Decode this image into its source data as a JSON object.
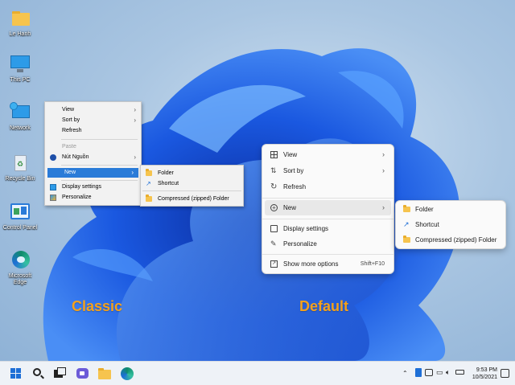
{
  "desktop_icons": [
    {
      "label": "Le Hanh",
      "icon": "folder-icon"
    },
    {
      "label": "This PC",
      "icon": "monitor-icon"
    },
    {
      "label": "Network",
      "icon": "network-icon"
    },
    {
      "label": "Recycle Bin",
      "icon": "recycle-bin-icon"
    },
    {
      "label": "Control Panel",
      "icon": "control-panel-icon"
    },
    {
      "label": "Microsoft Edge",
      "icon": "edge-icon"
    }
  ],
  "classic_menu": {
    "items": [
      {
        "label": "View",
        "has_submenu": true
      },
      {
        "label": "Sort by",
        "has_submenu": true
      },
      {
        "label": "Refresh"
      },
      {
        "label": "Paste",
        "disabled": true
      },
      {
        "label": "Nút Nguồn",
        "has_submenu": true,
        "icon": "power-icon"
      },
      {
        "label": "New",
        "has_submenu": true,
        "highlighted": true
      },
      {
        "label": "Display settings",
        "icon": "display-icon"
      },
      {
        "label": "Personalize",
        "icon": "personalize-icon"
      }
    ],
    "submenu": [
      {
        "label": "Folder",
        "icon": "folder-icon"
      },
      {
        "label": "Shortcut",
        "icon": "shortcut-icon"
      },
      {
        "label": "Compressed (zipped) Folder",
        "icon": "zip-folder-icon"
      }
    ]
  },
  "default_menu": {
    "items": [
      {
        "label": "View",
        "has_submenu": true,
        "icon": "grid-icon"
      },
      {
        "label": "Sort by",
        "has_submenu": true,
        "icon": "sort-icon"
      },
      {
        "label": "Refresh",
        "icon": "refresh-icon"
      },
      {
        "label": "New",
        "has_submenu": true,
        "icon": "plus-circle-icon",
        "highlighted": true
      },
      {
        "label": "Display settings",
        "icon": "display-icon"
      },
      {
        "label": "Personalize",
        "icon": "brush-icon"
      },
      {
        "label": "Show more options",
        "shortcut": "Shift+F10",
        "icon": "more-options-icon"
      }
    ],
    "submenu": [
      {
        "label": "Folder",
        "icon": "folder-icon"
      },
      {
        "label": "Shortcut",
        "icon": "shortcut-icon"
      },
      {
        "label": "Compressed (zipped) Folder",
        "icon": "zip-folder-icon"
      }
    ]
  },
  "captions": {
    "classic": "Classic",
    "default": "Default"
  },
  "taskbar": {
    "buttons": [
      "start-icon",
      "search-icon",
      "task-view-icon",
      "chat-icon",
      "file-explorer-icon",
      "edge-icon"
    ],
    "clock_time": "9:53 PM",
    "clock_date": "10/5/2021"
  },
  "colors": {
    "accent": "#2a7bd8",
    "caption": "#f4a11c",
    "bloom": "#1d5fe0"
  }
}
